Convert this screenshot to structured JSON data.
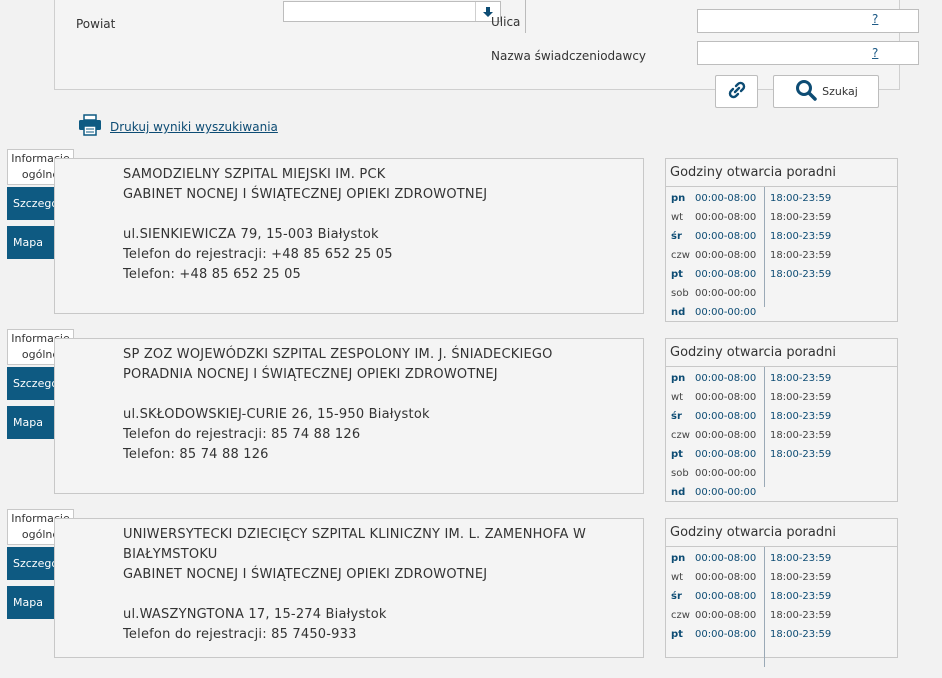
{
  "search": {
    "powiat_label": "Powiat",
    "ulica_label": "Ulica",
    "provider_label": "Nazwa świadczeniodawcy",
    "help": "?",
    "search_button": "Szukaj"
  },
  "print_link": "Drukuj wyniki wyszukiwania",
  "tabs": {
    "info_line1": "Informacje",
    "info_line2": "ogólne",
    "details": "Szczegóły",
    "map": "Mapa"
  },
  "hours_title": "Godziny otwarcia poradni",
  "results": [
    {
      "lines": [
        "SAMODZIELNY SZPITAL MIEJSKI IM. PCK",
        "GABINET NOCNEJ I ŚWIĄTECZNEJ OPIEKI ZDROWOTNEJ",
        "",
        "ul.SIENKIEWICZA 79, 15-003 Białystok",
        "Telefon do rejestracji: +48 85 652 25 05",
        "Telefon: +48 85 652 25 05"
      ],
      "hours": [
        {
          "day": "pn",
          "t1": "00:00-08:00",
          "t2": "18:00-23:59"
        },
        {
          "day": "wt",
          "t1": "00:00-08:00",
          "t2": "18:00-23:59"
        },
        {
          "day": "śr",
          "t1": "00:00-08:00",
          "t2": "18:00-23:59"
        },
        {
          "day": "czw",
          "t1": "00:00-08:00",
          "t2": "18:00-23:59"
        },
        {
          "day": "pt",
          "t1": "00:00-08:00",
          "t2": "18:00-23:59"
        },
        {
          "day": "sob",
          "t1": "00:00-00:00",
          "t2": ""
        },
        {
          "day": "nd",
          "t1": "00:00-00:00",
          "t2": ""
        }
      ]
    },
    {
      "lines": [
        "SP ZOZ WOJEWÓDZKI SZPITAL ZESPOLONY IM. J. ŚNIADECKIEGO",
        "PORADNIA NOCNEJ I ŚWIĄTECZNEJ OPIEKI ZDROWOTNEJ",
        "",
        "ul.SKŁODOWSKIEJ-CURIE 26, 15-950 Białystok",
        "Telefon do rejestracji: 85 74 88 126",
        "Telefon: 85 74 88 126"
      ],
      "hours": [
        {
          "day": "pn",
          "t1": "00:00-08:00",
          "t2": "18:00-23:59"
        },
        {
          "day": "wt",
          "t1": "00:00-08:00",
          "t2": "18:00-23:59"
        },
        {
          "day": "śr",
          "t1": "00:00-08:00",
          "t2": "18:00-23:59"
        },
        {
          "day": "czw",
          "t1": "00:00-08:00",
          "t2": "18:00-23:59"
        },
        {
          "day": "pt",
          "t1": "00:00-08:00",
          "t2": "18:00-23:59"
        },
        {
          "day": "sob",
          "t1": "00:00-00:00",
          "t2": ""
        },
        {
          "day": "nd",
          "t1": "00:00-00:00",
          "t2": ""
        }
      ]
    },
    {
      "lines": [
        "UNIWERSYTECKI DZIECIĘCY SZPITAL KLINICZNY IM. L. ZAMENHOFA W",
        "BIAŁYMSTOKU",
        "GABINET NOCNEJ I ŚWIĄTECZNEJ OPIEKI ZDROWOTNEJ",
        "",
        "ul.WASZYNGTONA 17, 15-274 Białystok",
        "Telefon do rejestracji: 85 7450-933"
      ],
      "hours": [
        {
          "day": "pn",
          "t1": "00:00-08:00",
          "t2": "18:00-23:59"
        },
        {
          "day": "wt",
          "t1": "00:00-08:00",
          "t2": "18:00-23:59"
        },
        {
          "day": "śr",
          "t1": "00:00-08:00",
          "t2": "18:00-23:59"
        },
        {
          "day": "czw",
          "t1": "00:00-08:00",
          "t2": "18:00-23:59"
        },
        {
          "day": "pt",
          "t1": "00:00-08:00",
          "t2": "18:00-23:59"
        }
      ]
    }
  ]
}
